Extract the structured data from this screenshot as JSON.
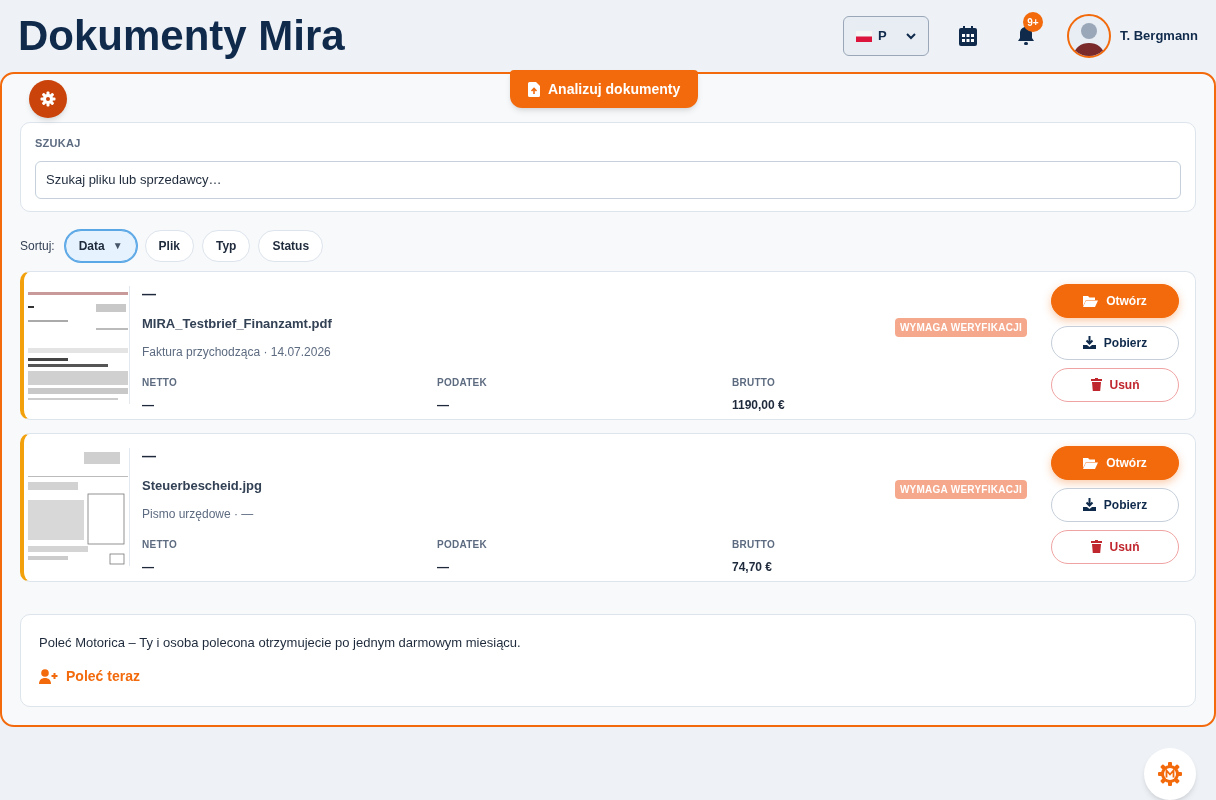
{
  "header": {
    "title": "Dokumenty Mira",
    "language": "P",
    "notifications_badge": "9+",
    "user_name": "T. Bergmann"
  },
  "analyze_button": "Analizuj dokumenty",
  "search": {
    "label": "SZUKAJ",
    "placeholder": "Szukaj pliku lub sprzedawcy…"
  },
  "sort": {
    "label": "Sortuj:",
    "options": [
      {
        "label": "Data",
        "arrow": "▼",
        "selected": true
      },
      {
        "label": "Plik",
        "selected": false
      },
      {
        "label": "Typ",
        "selected": false
      },
      {
        "label": "Status",
        "selected": false
      }
    ]
  },
  "documents": [
    {
      "title": "—",
      "file_name": "MIRA_Testbrief_Finanzamt.pdf",
      "subtitle": "Faktura przychodząca · 14.07.2026",
      "badge": "WYMAGA WERYFIKACJI",
      "fields": [
        {
          "label": "NETTO",
          "value": "—"
        },
        {
          "label": "PODATEK",
          "value": "—"
        },
        {
          "label": "BRUTTO",
          "value": "1190,00 €"
        }
      ],
      "actions": [
        "Otwórz",
        "Pobierz",
        "Usuń"
      ]
    },
    {
      "title": "—",
      "file_name": "Steuerbescheid.jpg",
      "subtitle": "Pismo urzędowe · —",
      "badge": "WYMAGA WERYFIKACJI",
      "fields": [
        {
          "label": "NETTO",
          "value": "—"
        },
        {
          "label": "PODATEK",
          "value": "—"
        },
        {
          "label": "BRUTTO",
          "value": "74,70 €"
        }
      ],
      "actions": [
        "Otwórz",
        "Pobierz",
        "Usuń"
      ]
    }
  ],
  "referral": {
    "text": "Poleć Motorica – Ty i osoba polecona otrzymujecie po jednym darmowym miesiącu.",
    "link": "Poleć teraz"
  }
}
